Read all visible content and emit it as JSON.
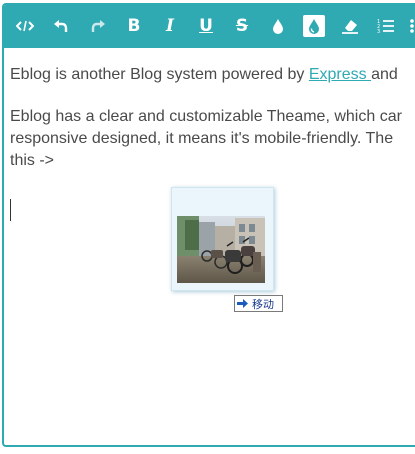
{
  "toolbar": {
    "buttons": [
      {
        "name": "code-view",
        "icon": "code-icon",
        "label": ""
      },
      {
        "name": "undo",
        "icon": "undo-icon",
        "label": ""
      },
      {
        "name": "redo",
        "icon": "redo-icon",
        "label": ""
      },
      {
        "name": "bold",
        "icon": "bold-icon",
        "label": "B"
      },
      {
        "name": "italic",
        "icon": "italic-icon",
        "label": "I"
      },
      {
        "name": "underline",
        "icon": "underline-icon",
        "label": "U"
      },
      {
        "name": "strikethrough",
        "icon": "strikethrough-icon",
        "label": "S"
      },
      {
        "name": "text-color",
        "icon": "drop-icon",
        "label": ""
      },
      {
        "name": "background-color",
        "icon": "drop-filled-icon",
        "label": "",
        "active": true
      },
      {
        "name": "clear-format",
        "icon": "eraser-icon",
        "label": ""
      },
      {
        "name": "ordered-list",
        "icon": "ordered-list-icon",
        "label": ""
      },
      {
        "name": "unordered-list",
        "icon": "unordered-list-icon",
        "label": ""
      }
    ],
    "accent_color": "#2fa9b2"
  },
  "content": {
    "paragraph1": {
      "before_link": "Eblog is another Blog system powered by ",
      "link_text": "Express ",
      "after_link": "and"
    },
    "paragraph2": {
      "line1": "Eblog has a clear and customizable Theame, which car",
      "line2": "responsive designed, it means it's mobile-friendly. The",
      "line3": "this ->"
    }
  },
  "drag_tooltip": {
    "icon": "arrow-right-icon",
    "label": "移动"
  }
}
